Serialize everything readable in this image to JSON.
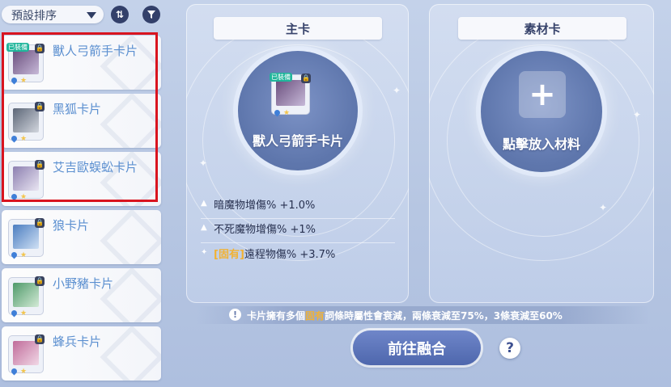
{
  "toolbar": {
    "sort_value": "預設排序",
    "order_toggle_glyph": "⇅",
    "filter_glyph": "▼"
  },
  "card_list": [
    {
      "label": "獸人弓箭手卡片",
      "equipped": true,
      "badge": "已裝備",
      "art_color": "#6a4e7d"
    },
    {
      "label": "黑狐卡片",
      "equipped": false,
      "badge": "",
      "art_color": "#5c6677"
    },
    {
      "label": "艾吉歐蜈蚣卡片",
      "equipped": false,
      "badge": "",
      "art_color": "#8c7fb0"
    },
    {
      "label": "狼卡片",
      "equipped": false,
      "badge": "",
      "art_color": "#4b7dc0"
    },
    {
      "label": "小野豬卡片",
      "equipped": false,
      "badge": "",
      "art_color": "#4f9a6a"
    },
    {
      "label": "蜂兵卡片",
      "equipped": false,
      "badge": "",
      "art_color": "#c06b9a"
    }
  ],
  "main_card": {
    "title": "主卡",
    "card_name": "獸人弓箭手卡片",
    "badge": "已裝備"
  },
  "material_card": {
    "title": "素材卡",
    "placeholder": "點擊放入材料",
    "plus_glyph": "+"
  },
  "stats": [
    {
      "prefix": "",
      "text": "暗魔物增傷% +1.0%",
      "marker": "▲"
    },
    {
      "prefix": "",
      "text": "不死魔物增傷% +1%",
      "marker": "▲"
    },
    {
      "prefix": "[固有]",
      "text": "遠程物傷% +3.7%",
      "marker": "✦"
    }
  ],
  "notice": {
    "before": "卡片擁有多個",
    "highlight": "固有",
    "after": "詞條時屬性會衰減，兩條衰減至75%，3條衰減至60%",
    "icon_glyph": "!"
  },
  "actions": {
    "fusion_label": "前往融合",
    "help_glyph": "?"
  },
  "colors": {
    "accent": "#5b8fd0",
    "selection_frame": "#d9141f",
    "fixed_tag": "#f2b233",
    "equipped_badge": "#20b59b"
  }
}
